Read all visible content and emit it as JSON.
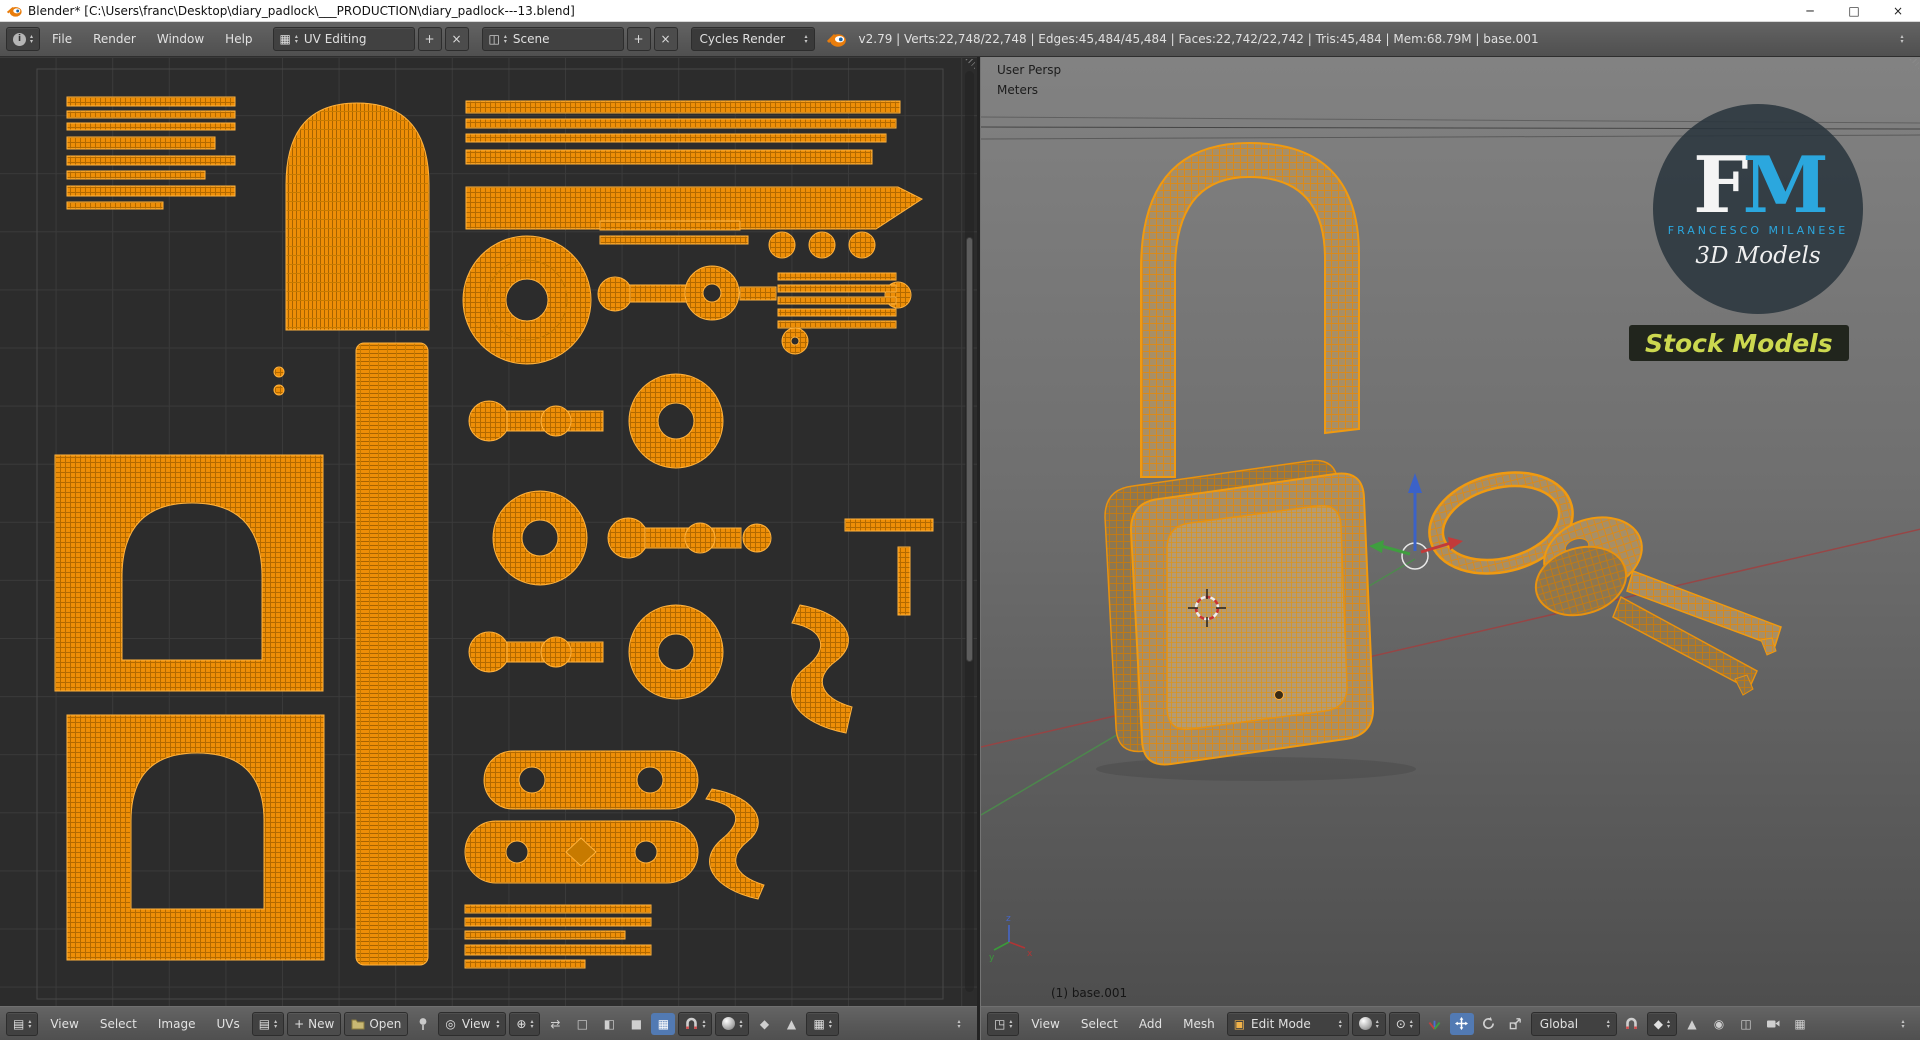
{
  "window": {
    "title": "Blender* [C:\\Users\\franc\\Desktop\\diary_padlock\\___PRODUCTION\\diary_padlock---13.blend]"
  },
  "info_bar": {
    "menus": [
      "File",
      "Render",
      "Window",
      "Help"
    ],
    "layout_value": "UV Editing",
    "scene_value": "Scene",
    "engine_value": "Cycles Render",
    "stats": "v2.79 | Verts:22,748/22,748 | Edges:45,484/45,484 | Faces:22,742/22,742 | Tris:45,484 | Mem:68.79M | base.001"
  },
  "uv_editor": {
    "header": {
      "menus": [
        "View",
        "Select",
        "Image",
        "UVs"
      ],
      "new_label": "New",
      "open_label": "Open",
      "view_label": "View"
    }
  },
  "viewport3d": {
    "view_name": "User Persp",
    "units": "Meters",
    "object_info": "(1) base.001",
    "header": {
      "menus": [
        "View",
        "Select",
        "Add",
        "Mesh"
      ],
      "mode_value": "Edit Mode",
      "orientation_value": "Global"
    },
    "watermark": {
      "initial_f": "F",
      "initial_m": "M",
      "studio": "FRANCESCO MILANESE",
      "tagline": "3D Models",
      "badge": "Stock Models"
    }
  },
  "icons": {
    "minimize": "─",
    "maximize": "□",
    "close": "×",
    "plus": "+",
    "layout": "▦",
    "scene": "◫",
    "image": "▤",
    "view_mode": "◎",
    "pivot": "⊕",
    "sync": "⇄",
    "draw_outline": "□",
    "draw_dash": "◧",
    "draw_solid": "■",
    "draw_texture": "▦",
    "prop": "◉",
    "diamond": "◆",
    "triangle": "▲",
    "editor_3d": "◳",
    "edit_mode": "▣",
    "pivot3d": "⊙",
    "occlude": "◫",
    "panel_toggle": "▴"
  },
  "colors": {
    "uv_orange": "#ee8e07",
    "wire_orange": "#f09a10",
    "accent_blue": "#527ab3",
    "logo_blue": "#2ba7de",
    "badge_green": "#ccd84f"
  }
}
